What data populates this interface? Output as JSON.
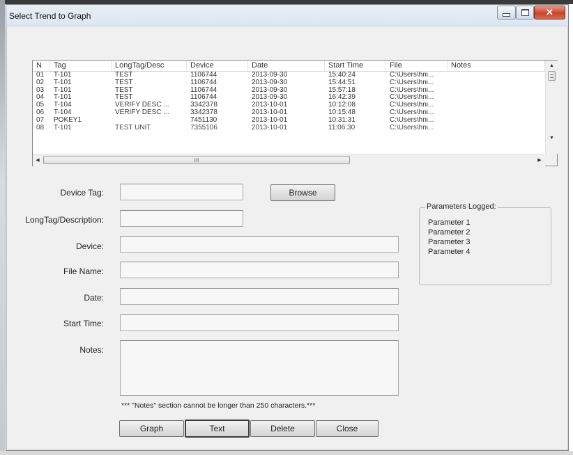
{
  "window": {
    "title": "Select Trend to Graph",
    "close_glyph": "✕"
  },
  "table": {
    "columns": [
      "N",
      "Tag",
      "LongTag/Desc",
      "Device",
      "Date",
      "Start Time",
      "File",
      "Notes"
    ],
    "rows": [
      [
        "01",
        "T-101",
        "TEST",
        "1106744",
        "2013-09-30",
        "15:40:24",
        "C:\\Users\\hni...",
        ""
      ],
      [
        "02",
        "T-101",
        "TEST",
        "1106744",
        "2013-09-30",
        "15:44:51",
        "C:\\Users\\hni...",
        ""
      ],
      [
        "03",
        "T-101",
        "TEST",
        "1106744",
        "2013-09-30",
        "15:57:18",
        "C:\\Users\\hni...",
        ""
      ],
      [
        "04",
        "T-101",
        "TEST",
        "1106744",
        "2013-09-30",
        "16:42:39",
        "C:\\Users\\hni...",
        ""
      ],
      [
        "05",
        "T-104",
        "VERIFY DESC ...",
        "3342378",
        "2013-10-01",
        "10:12:08",
        "C:\\Users\\hni...",
        ""
      ],
      [
        "06",
        "T-104",
        "VERIFY DESC ...",
        "3342378",
        "2013-10-01",
        "10:15:48",
        "C:\\Users\\hni...",
        ""
      ],
      [
        "07",
        "POKEY1",
        "",
        "7451130",
        "2013-10-01",
        "10:31:31",
        "C:\\Users\\hni...",
        ""
      ],
      [
        "08",
        "T-101",
        "TEST UNIT",
        "7355106",
        "2013-10-01",
        "11:06:30",
        "C:\\Users\\hni...",
        ""
      ]
    ],
    "hscroll_grip": "III"
  },
  "form": {
    "device_tag_label": "Device Tag:",
    "longtag_label": "LongTag/Description:",
    "device_label": "Device:",
    "file_name_label": "File Name:",
    "date_label": "Date:",
    "start_time_label": "Start Time:",
    "notes_label": "Notes:",
    "browse_label": "Browse",
    "notes_hint": "*** \"Notes\" section cannot be longer than 250 characters.***"
  },
  "parameters": {
    "title": "Parameters Logged:",
    "items": [
      "Parameter 1",
      "Parameter 2",
      "Parameter 3",
      "Parameter 4"
    ]
  },
  "buttons": {
    "graph": "Graph",
    "text": "Text",
    "delete": "Delete",
    "close": "Close"
  }
}
